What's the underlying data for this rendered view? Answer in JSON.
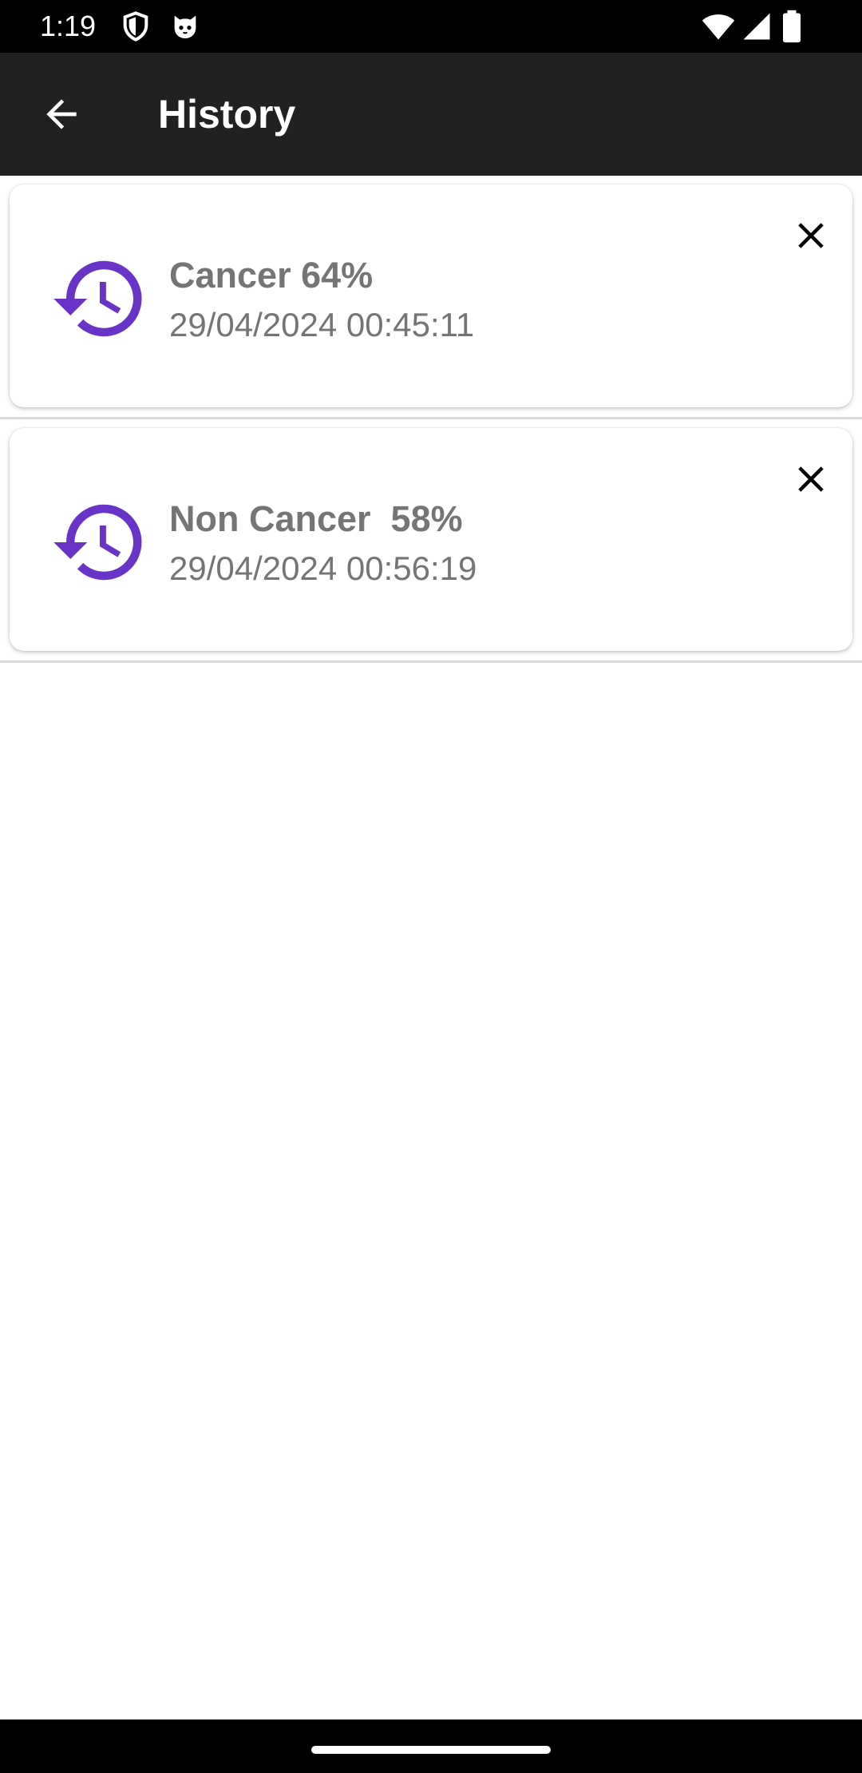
{
  "status_bar": {
    "time": "1:19",
    "left_icons": [
      "shield-icon",
      "cat-face-icon"
    ],
    "right_icons": [
      "wifi-icon",
      "signal-icon",
      "battery-icon"
    ]
  },
  "app_bar": {
    "title": "History",
    "back_icon": "arrow-back-icon",
    "background_color": "#212121"
  },
  "history": {
    "icon": "history-clock-icon",
    "icon_color": "#6A33C7",
    "delete_icon": "close-icon",
    "items": [
      {
        "title": "Cancer 64%",
        "date": "29/04/2024 00:45:11"
      },
      {
        "title": "Non Cancer  58%",
        "date": "29/04/2024 00:56:19"
      }
    ]
  }
}
